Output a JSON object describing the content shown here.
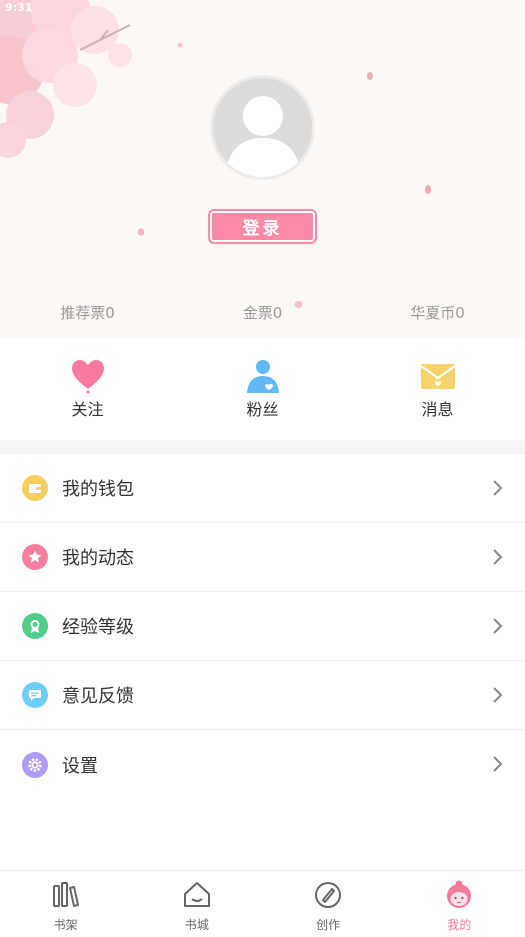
{
  "status_bar": {
    "time": "9:31"
  },
  "profile": {
    "login_label": "登录"
  },
  "stats": [
    {
      "label": "推荐票0"
    },
    {
      "label": "金票0"
    },
    {
      "label": "华夏币0"
    }
  ],
  "quick_actions": [
    {
      "label": "关注",
      "icon": "heart-icon",
      "color": "#f87a9e"
    },
    {
      "label": "粉丝",
      "icon": "fan-icon",
      "color": "#62b8f5"
    },
    {
      "label": "消息",
      "icon": "envelope-icon",
      "color": "#f7d36b"
    }
  ],
  "menu": [
    {
      "label": "我的钱包",
      "icon": "wallet-icon",
      "color": "#f7cf5e"
    },
    {
      "label": "我的动态",
      "icon": "star-icon",
      "color": "#f77fa0"
    },
    {
      "label": "经验等级",
      "icon": "badge-icon",
      "color": "#53cc8b"
    },
    {
      "label": "意见反馈",
      "icon": "feedback-icon",
      "color": "#6ccdf7"
    },
    {
      "label": "设置",
      "icon": "gear-icon",
      "color": "#b19af5"
    }
  ],
  "tabs": [
    {
      "label": "书架",
      "icon": "bookshelf-icon",
      "active": false
    },
    {
      "label": "书城",
      "icon": "house-icon",
      "active": false
    },
    {
      "label": "创作",
      "icon": "pen-icon",
      "active": false
    },
    {
      "label": "我的",
      "icon": "girl-face-icon",
      "active": true
    }
  ],
  "colors": {
    "accent": "#fb8aa6",
    "active_tab": "#f47a9b",
    "header_bg": "#fbf8f6"
  }
}
